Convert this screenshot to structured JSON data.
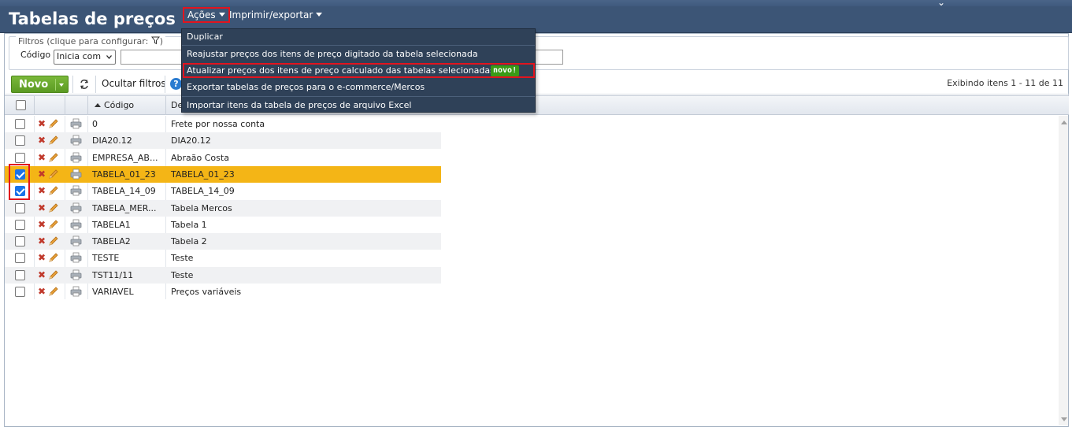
{
  "page": {
    "title": "Tabelas de preços",
    "menus": {
      "acoes": "Ações",
      "imprimir": "Imprimir/exportar"
    }
  },
  "filters": {
    "legend": "Filtros (clique para configurar:",
    "legend_end": ")",
    "field_label": "Código",
    "operator_selected": "Inicia com",
    "value": ""
  },
  "toolbar": {
    "new_label": "Novo",
    "hide_filters": "Ocultar filtros",
    "help": "?",
    "showing": "Exibindo itens 1 - 11 de 11"
  },
  "grid": {
    "columns": {
      "code": "Código",
      "desc": "De"
    },
    "rows": [
      {
        "code": "0",
        "desc": "Frete por nossa conta",
        "checked": false
      },
      {
        "code": "DIA20.12",
        "desc": "DIA20.12",
        "checked": false
      },
      {
        "code": "EMPRESA_AB...",
        "desc": "Abraão Costa",
        "checked": false
      },
      {
        "code": "TABELA_01_23",
        "desc": "TABELA_01_23",
        "checked": true
      },
      {
        "code": "TABELA_14_09",
        "desc": "TABELA_14_09",
        "checked": true
      },
      {
        "code": "TABELA_MER...",
        "desc": "Tabela Mercos",
        "checked": false
      },
      {
        "code": "TABELA1",
        "desc": "Tabela 1",
        "checked": false
      },
      {
        "code": "TABELA2",
        "desc": "Tabela 2",
        "checked": false
      },
      {
        "code": "TESTE",
        "desc": "Teste",
        "checked": false
      },
      {
        "code": "TST11/11",
        "desc": "Teste",
        "checked": false
      },
      {
        "code": "VARIAVEL",
        "desc": "Preços variáveis",
        "checked": false
      }
    ]
  },
  "actions_menu": {
    "items": [
      "Duplicar",
      "Reajustar preços dos itens de preço digitado da tabela selecionada",
      "Atualizar preços dos itens de preço calculado das tabelas selecionadas",
      "Exportar tabelas de preços para o e-commerce/Mercos",
      "Importar itens da tabela de preços de arquivo Excel"
    ],
    "badge": "novo!"
  },
  "colors": {
    "header_bg": "#3c5576",
    "new_button": "#6aaa2c",
    "selected_row": "#f4b516",
    "highlight_frame": "#e2141e",
    "menu_bg": "#2f4158"
  }
}
